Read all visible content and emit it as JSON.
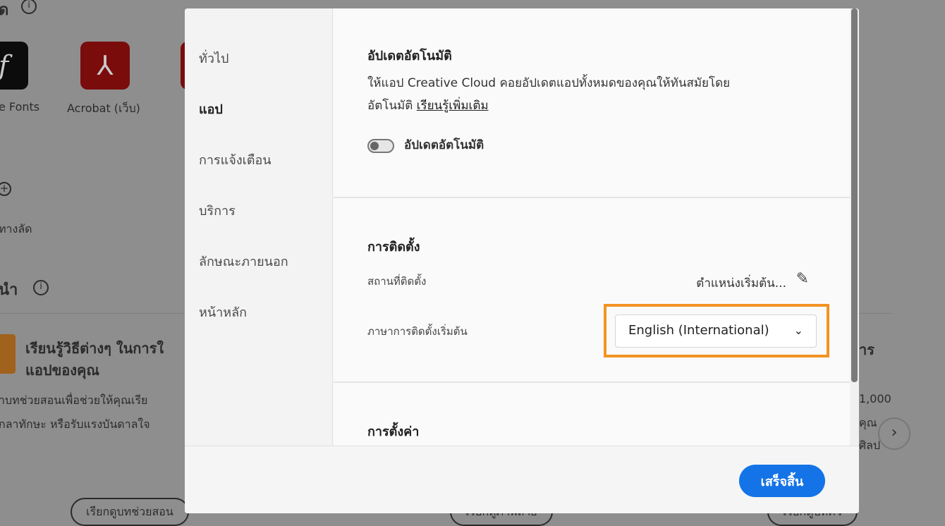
{
  "background": {
    "section1_title_fragment": "ด",
    "apps": [
      {
        "label": "e Fonts",
        "icon": "fonts-icon"
      },
      {
        "label": "Acrobat (เว็บ)",
        "icon": "acrobat-icon"
      }
    ],
    "shortcut_label": "ทางลัด",
    "section2_title_fragment": "นำ",
    "card_title_line1": "เรียนรู้วิธีต่างๆ ในการใ",
    "card_title_line2": "แอปของคุณ",
    "card_desc_line1": "าบทช่วยสอนเพื่อช่วยให้คุณเรีย",
    "card_desc_line2": "กลาทักษะ หรือรับแรงบันดาลใจ",
    "right_card_fragment": "าร",
    "right_text_1": "1,000",
    "right_text_2": "คุณ",
    "right_text_3": "ศิลป",
    "pill_1": "เรียกดูบทช่วยสอน",
    "pill_2": "เรียกดูภาพถ่าย",
    "pill_3": "เรียกดูบทคว"
  },
  "dialog": {
    "nav": [
      "ทั่วไป",
      "แอป",
      "การแจ้งเตือน",
      "บริการ",
      "ลักษณะภายนอก",
      "หน้าหลัก"
    ],
    "active_nav": "แอป",
    "auto_update": {
      "title": "อัปเดตอัตโนมัติ",
      "desc_line1": "ให้แอป Creative Cloud คอยอัปเดตแอปทั้งหมดของคุณให้ทันสมัยโดย",
      "desc_line2": "อัตโนมัติ",
      "learn_more": "เรียนรู้เพิ่มเติม",
      "toggle_label": "อัปเดตอัตโนมัติ",
      "toggle_on": false
    },
    "install": {
      "title": "การติดตั้ง",
      "location_label": "สถานที่ติดตั้ง",
      "location_value": "ตำแหน่งเริ่มต้น...",
      "language_label": "ภาษาการติดตั้งเริ่มต้น",
      "language_value": "English (International)"
    },
    "settings": {
      "title": "การตั้งค่า"
    },
    "done_button": "เสร็จสิ้น"
  },
  "colors": {
    "accent": "#1473e6",
    "highlight": "#f29423"
  }
}
